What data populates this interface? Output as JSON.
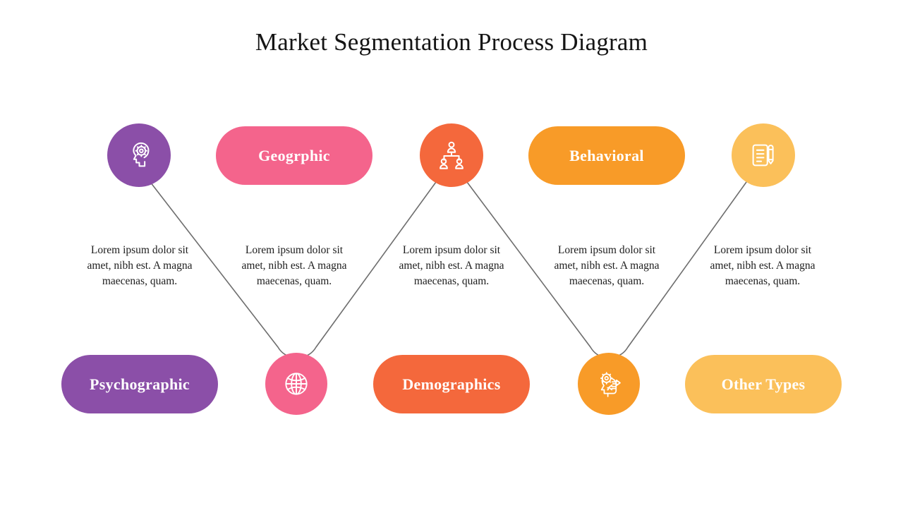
{
  "page": {
    "title": "Market Segmentation Process Diagram",
    "background": "#ffffff",
    "connector_color": "#6e6e6e"
  },
  "colors": {
    "purple": "#8b4fa8",
    "pink": "#f4648c",
    "orange_red": "#f4683c",
    "orange": "#f89b28",
    "amber": "#fbc05a",
    "text_dark": "#1d1d1d",
    "text_light": "#ffffff"
  },
  "top_row": [
    {
      "kind": "circle",
      "icon": "head-gear-icon",
      "color": "#8b4fa8",
      "label": ""
    },
    {
      "kind": "pill",
      "label": "Geogrphic",
      "color": "#f4648c"
    },
    {
      "kind": "circle",
      "icon": "people-hierarchy-icon",
      "color": "#f4683c",
      "label": ""
    },
    {
      "kind": "pill",
      "label": "Behavioral",
      "color": "#f89b28"
    },
    {
      "kind": "circle",
      "icon": "document-pencil-icon",
      "color": "#fbc05a",
      "label": ""
    }
  ],
  "bottom_row": [
    {
      "kind": "pill",
      "label": "Psychographic",
      "color": "#8b4fa8"
    },
    {
      "kind": "circle",
      "icon": "globe-icon",
      "color": "#f4648c",
      "label": ""
    },
    {
      "kind": "pill",
      "label": "Demographics",
      "color": "#f4683c"
    },
    {
      "kind": "circle",
      "icon": "head-gear-arrows-icon",
      "color": "#f89b28",
      "label": ""
    },
    {
      "kind": "pill",
      "label": "Other Types",
      "color": "#fbc05a"
    }
  ],
  "captions": [
    {
      "text": "Lorem ipsum dolor sit amet, nibh est. A magna maecenas, quam."
    },
    {
      "text": "Lorem ipsum dolor sit amet, nibh est. A magna maecenas, quam."
    },
    {
      "text": "Lorem ipsum dolor sit amet, nibh est. A magna maecenas, quam."
    },
    {
      "text": "Lorem ipsum dolor sit amet, nibh est. A magna maecenas, quam."
    },
    {
      "text": "Lorem ipsum dolor sit amet, nibh est. A magna maecenas, quam."
    }
  ]
}
